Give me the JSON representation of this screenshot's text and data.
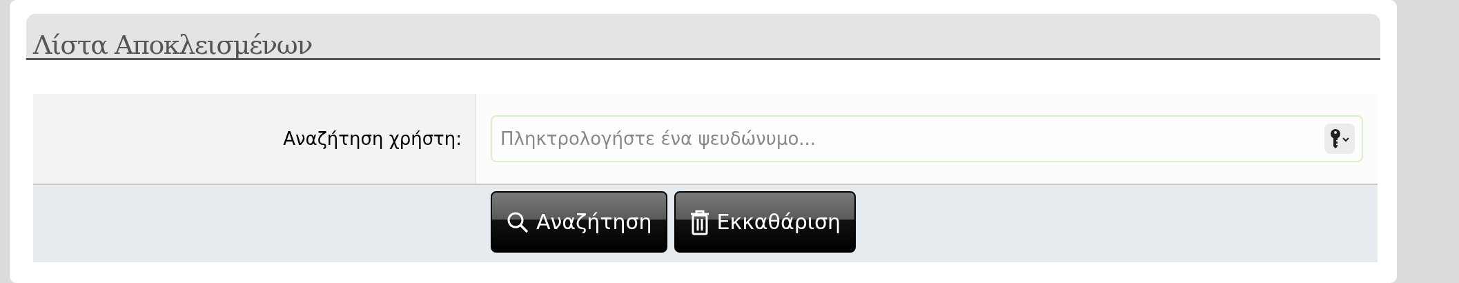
{
  "title": "Λίστα Αποκλεισμένων",
  "search": {
    "label": "Αναζήτηση χρήστη:",
    "placeholder": "Πληκτρολογήστε ένα ψευδώνυμο..."
  },
  "buttons": [
    {
      "kind": "search",
      "label": "Αναζήτηση"
    },
    {
      "kind": "clear",
      "label": "Εκκαθάριση"
    }
  ]
}
